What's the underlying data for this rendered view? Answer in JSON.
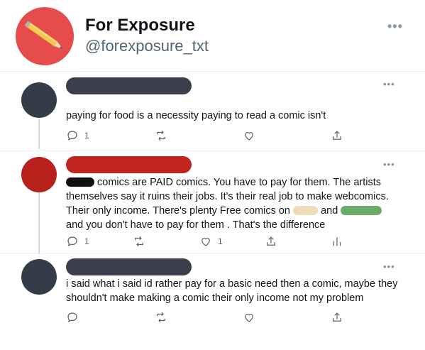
{
  "header": {
    "name": "For Exposure",
    "handle": "@forexposure_txt",
    "more": "•••"
  },
  "colors": {
    "header_avatar": "#e64c4c",
    "dark_avatar": "#343c48",
    "red_avatar": "#b8201c",
    "redact_dark": "#3a3f4b",
    "redact_red": "#c0261e",
    "redact_tan": "#eedcb8",
    "redact_green": "#6aab6a"
  },
  "replies": [
    {
      "text": "paying for food is a necessity paying to read a comic isn't",
      "reply_count": "1",
      "more": "•••"
    },
    {
      "text_1": "comics are PAID comics. You have to pay for them. The artists themselves say it ruins their jobs. It's their real job to make webcomics. Their only income. There's plenty Free comics on",
      "text_2": "and",
      "text_3": "and you don't have to pay for them . That's the difference",
      "reply_count": "1",
      "like_count": "1",
      "more": "•••"
    },
    {
      "text": "i said what i said id rather pay for a basic need then a comic, maybe they shouldn't make making a comic their only income not my problem",
      "more": "•••"
    }
  ]
}
